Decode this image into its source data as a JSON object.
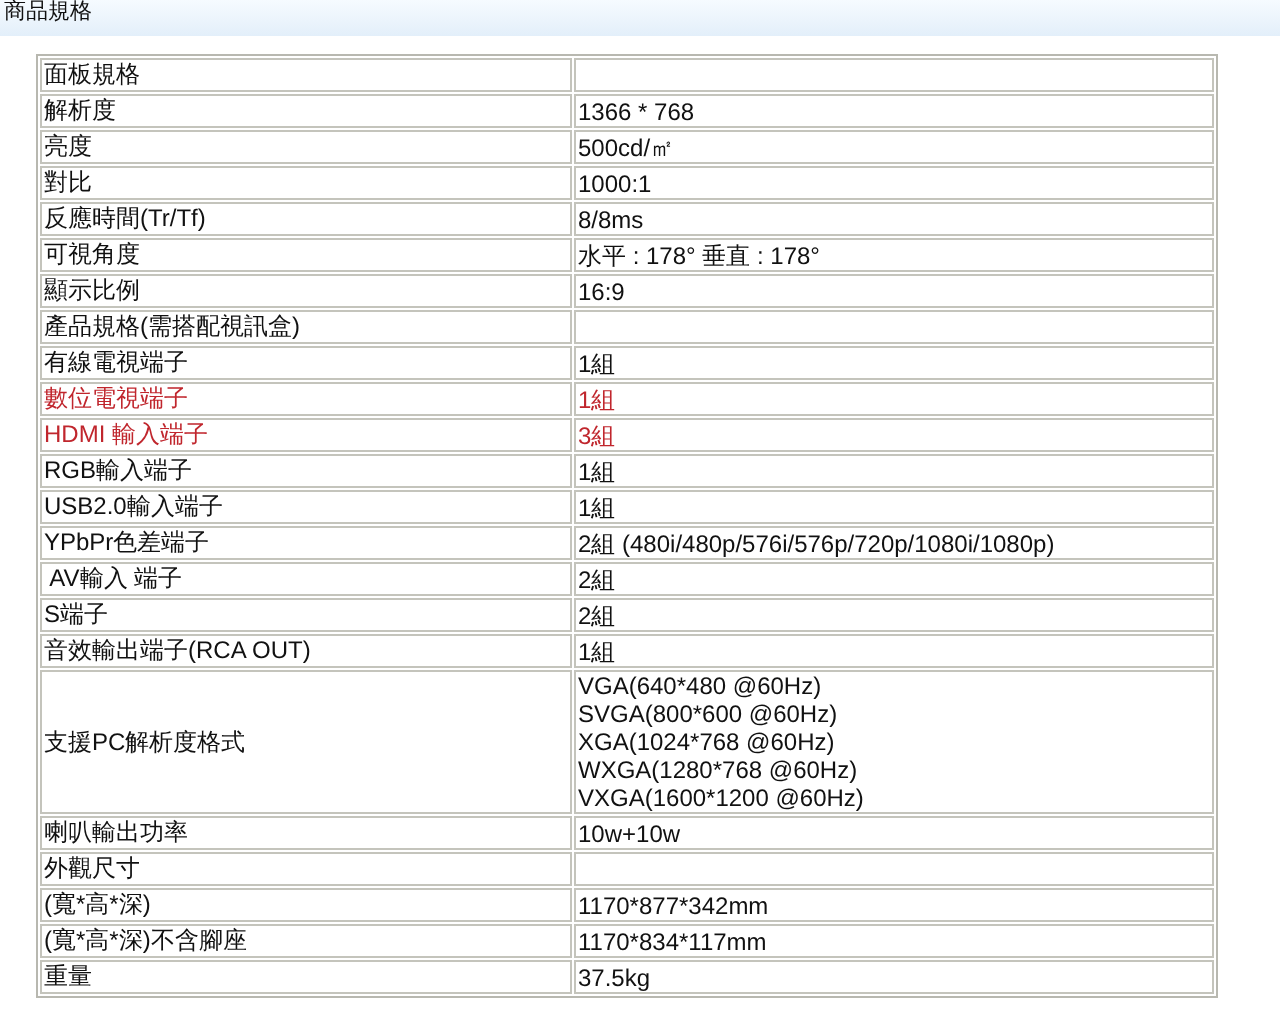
{
  "header": {
    "title": "商品規格"
  },
  "rows": [
    {
      "label": "面板規格",
      "highlighted": false
    },
    {
      "label": "解析度",
      "value": "1366 * 768",
      "highlighted": false
    },
    {
      "label": "亮度",
      "value": "500cd/㎡",
      "highlighted": false
    },
    {
      "label": "對比",
      "value": "1000:1",
      "highlighted": false
    },
    {
      "label": "反應時間(Tr/Tf)",
      "value": "8/8ms",
      "highlighted": false
    },
    {
      "label": "可視角度",
      "value": "水平 : 178° 垂直 : 178°",
      "highlighted": false
    },
    {
      "label": "顯示比例",
      "value": "16:9",
      "highlighted": false
    },
    {
      "label": "產品規格(需搭配視訊盒)",
      "highlighted": false
    },
    {
      "label": "有線電視端子",
      "value": "1組",
      "highlighted": false
    },
    {
      "label": "數位電視端子",
      "value": "1組",
      "highlighted": true
    },
    {
      "label": "HDMI 輸入端子",
      "value": "3組",
      "highlighted": true
    },
    {
      "label": "RGB輸入端子",
      "value": "1組",
      "highlighted": false
    },
    {
      "label": "USB2.0輸入端子",
      "value": "1組",
      "highlighted": false
    },
    {
      "label": "YPbPr色差端子",
      "value": "2組 (480i/480p/576i/576p/720p/1080i/1080p)",
      "highlighted": false
    },
    {
      "label": " AV輸入 端子",
      "value": "2組",
      "highlighted": false
    },
    {
      "label": "S端子",
      "value": "2組",
      "highlighted": false
    },
    {
      "label": "音效輸出端子(RCA OUT)",
      "value": "1組",
      "highlighted": false
    },
    {
      "label": "支援PC解析度格式",
      "value_lines": [
        "VGA(640*480 @60Hz)",
        "SVGA(800*600 @60Hz)",
        "XGA(1024*768 @60Hz)",
        "WXGA(1280*768 @60Hz)",
        "VXGA(1600*1200 @60Hz)"
      ],
      "highlighted": false
    },
    {
      "label": "喇叭輸出功率",
      "value": "10w+10w",
      "highlighted": false
    },
    {
      "label": "外觀尺寸",
      "highlighted": false
    },
    {
      "label": "(寬*高*深)",
      "value": "1170*877*342mm",
      "highlighted": false
    },
    {
      "label": "(寬*高*深)不含腳座",
      "value": "1170*834*117mm",
      "highlighted": false
    },
    {
      "label": "重量",
      "value": "37.5kg",
      "highlighted": false
    }
  ]
}
